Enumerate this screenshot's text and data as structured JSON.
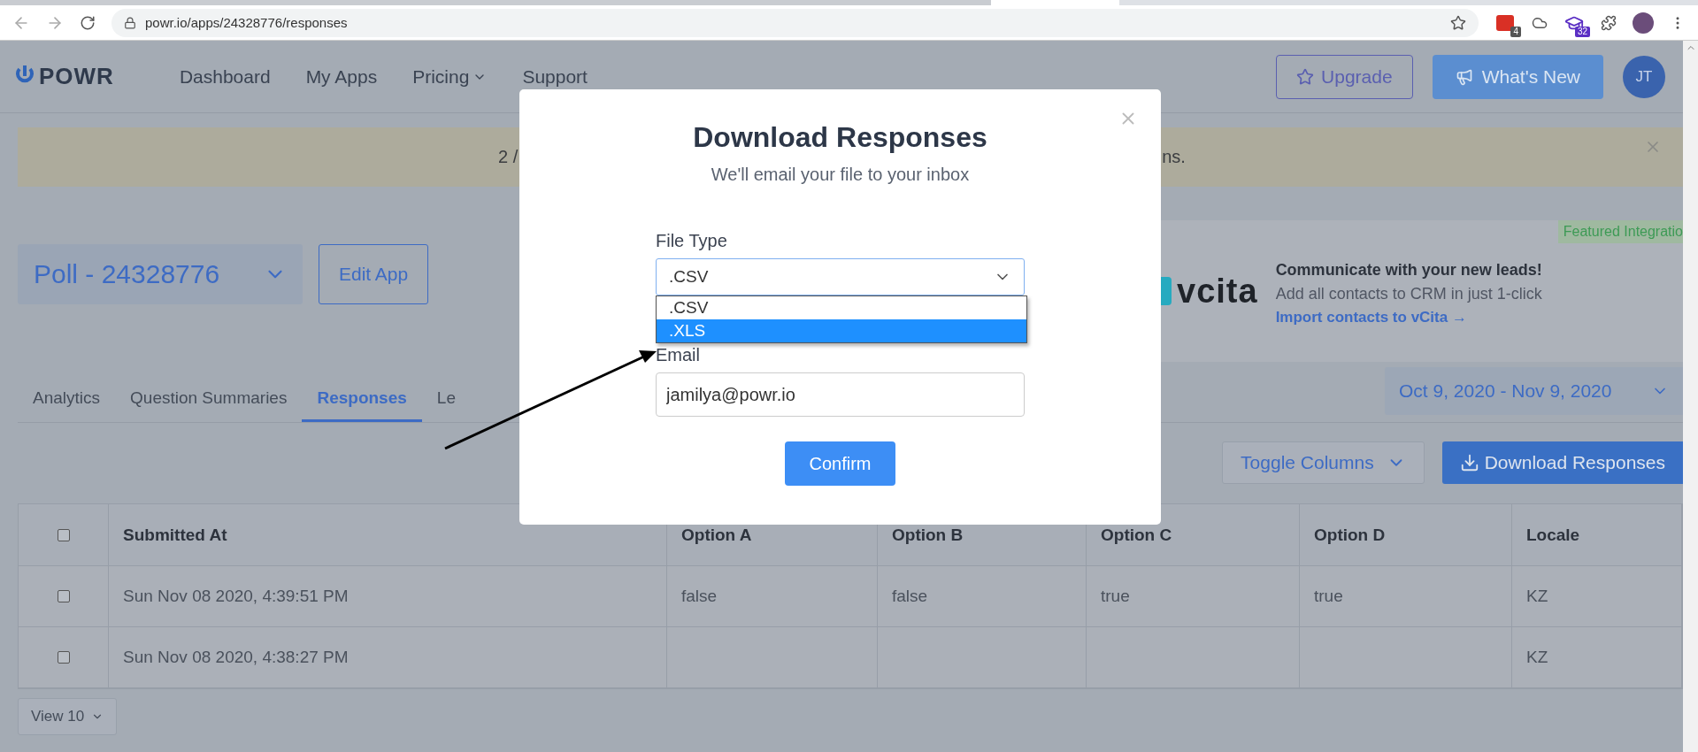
{
  "browser": {
    "url": "powr.io/apps/24328776/responses",
    "extension_badges": [
      "4",
      "32"
    ]
  },
  "header": {
    "logo": "POWR",
    "nav": [
      {
        "label": "Dashboard",
        "caret": false
      },
      {
        "label": "My Apps",
        "caret": false
      },
      {
        "label": "Pricing",
        "caret": true
      },
      {
        "label": "Support",
        "caret": false
      }
    ],
    "upgrade": "Upgrade",
    "whats_new": "What's New",
    "avatar": "JT"
  },
  "banner": {
    "text_start": "2 /",
    "text_end": "ns."
  },
  "app_selector": {
    "value": "Poll - 24328776"
  },
  "edit_button": "Edit App",
  "integration": {
    "badge": "Featured Integratio",
    "logo": "vcita",
    "heading": "Communicate with your new leads!",
    "text": "Add all contacts to CRM in just 1-click",
    "link": "Import contacts to vCita →"
  },
  "tabs": [
    {
      "label": "Analytics",
      "selected": false
    },
    {
      "label": "Question Summaries",
      "selected": false
    },
    {
      "label": "Responses",
      "selected": true
    },
    {
      "label": "Le",
      "selected": false
    }
  ],
  "date_range": "Oct 9, 2020 - Nov 9, 2020",
  "toolbar": {
    "toggle": "Toggle Columns",
    "download": "Download Responses"
  },
  "table": {
    "all_checked": false,
    "columns": [
      "Submitted At",
      "Option A",
      "Option B",
      "Option C",
      "Option D",
      "Locale"
    ],
    "rows": [
      {
        "checked": false,
        "cells": [
          "Sun Nov 08 2020, 4:39:51 PM",
          "false",
          "false",
          "true",
          "true",
          "KZ"
        ]
      },
      {
        "checked": false,
        "cells": [
          "Sun Nov 08 2020, 4:38:27 PM",
          "",
          "",
          "",
          "",
          "KZ"
        ]
      }
    ]
  },
  "pager": "View 10",
  "modal": {
    "title": "Download Responses",
    "subtitle": "We'll email your file to your inbox",
    "file_type_label": "File Type",
    "file_type_value": ".CSV",
    "options": [
      {
        "label": ".CSV",
        "selected": false
      },
      {
        "label": ".XLS",
        "selected": true
      }
    ],
    "email_label": "Email",
    "email_value": "jamilya@powr.io",
    "confirm": "Confirm"
  }
}
